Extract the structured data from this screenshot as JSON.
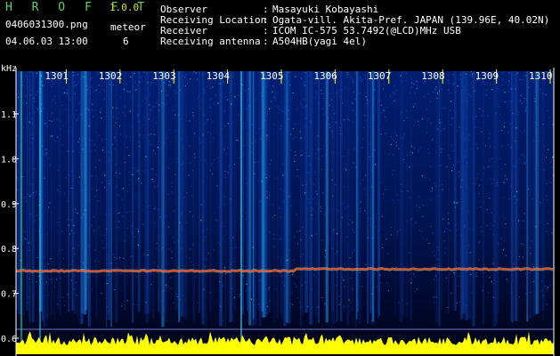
{
  "header": {
    "app_title": "H R O F F T",
    "version": "1.0.0",
    "filename": "0406031300.png",
    "meteor_label": "meteor",
    "datetime": "04.06.03 13:00",
    "meteor_count": "6",
    "info": [
      {
        "label": "Observer",
        "value": "Masayuki Kobayashi"
      },
      {
        "label": "Receiving Location",
        "value": "Ogata-vill. Akita-Pref. JAPAN (139.96E, 40.02N)"
      },
      {
        "label": "Receiver",
        "value": "ICOM IC-575 53.7492(@LCD)MHz USB"
      },
      {
        "label": "Receiving antenna",
        "value": "A504HB(yagi 4el)"
      }
    ],
    "separator": ":"
  },
  "colors": {
    "background": "#000000",
    "title": "#5fd25f",
    "version": "#d8e020",
    "labels": "#ffffff",
    "noise_floor": "#ffff00",
    "spectrum_low": "#001a66",
    "spectrum_high": "#00ffcc",
    "carrier": "#ff3030",
    "ticks": "#ffff00"
  },
  "chart_data": {
    "type": "heatmap",
    "y_unit": "kHz",
    "ylim": [
      0.6,
      1.2
    ],
    "y_ticks": [
      "1.1",
      "1.0",
      "0.9",
      "0.8",
      "0.7",
      "0.6"
    ],
    "x_ticks": [
      "1301",
      "1302",
      "1303",
      "1304",
      "1305",
      "1306",
      "1307",
      "1308",
      "1309",
      "1310"
    ],
    "carrier_khz": 0.75,
    "grid": false
  }
}
